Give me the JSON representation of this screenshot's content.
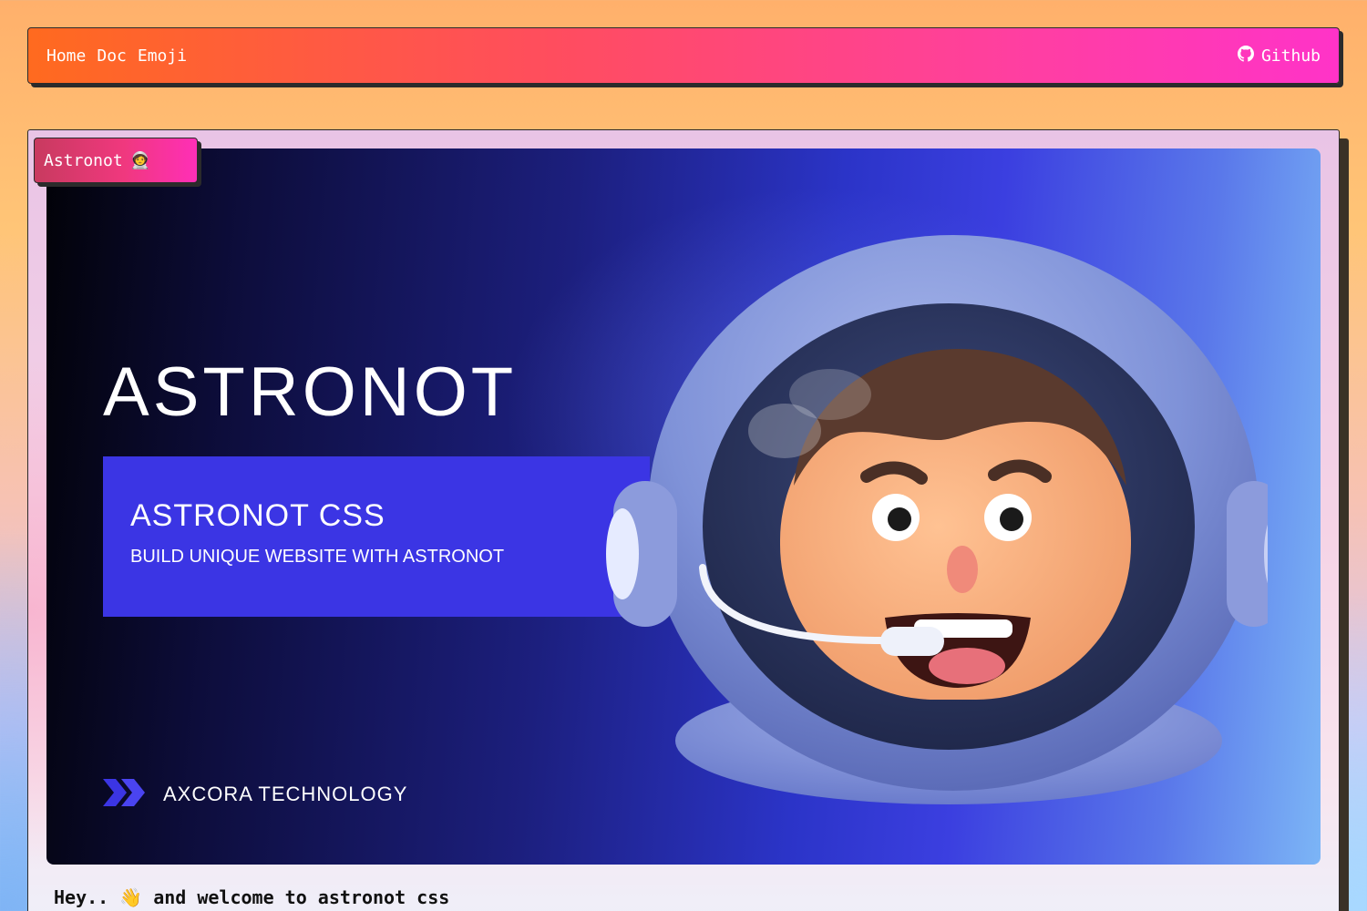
{
  "navbar": {
    "links": [
      {
        "label": "Home"
      },
      {
        "label": "Doc"
      },
      {
        "label": "Emoji"
      }
    ],
    "github_label": "Github",
    "github_icon": "github-icon",
    "gradient_start": "#ff6a1f",
    "gradient_end": "#ff33c8"
  },
  "card": {
    "tag_label": "Astronot",
    "tag_emoji": "🧑‍🚀"
  },
  "banner": {
    "title": "ASTRONOT",
    "subtitle": "ASTRONOT CSS",
    "tagline": "BUILD UNIQUE WEBSITE WITH ASTRONOT",
    "brand_name": "AXCORA TECHNOLOGY",
    "brand_icon": "chevrons-right-icon",
    "box_color": "#3b35e4"
  },
  "welcome_text": "Hey.. 👋 and welcome to astronot css"
}
